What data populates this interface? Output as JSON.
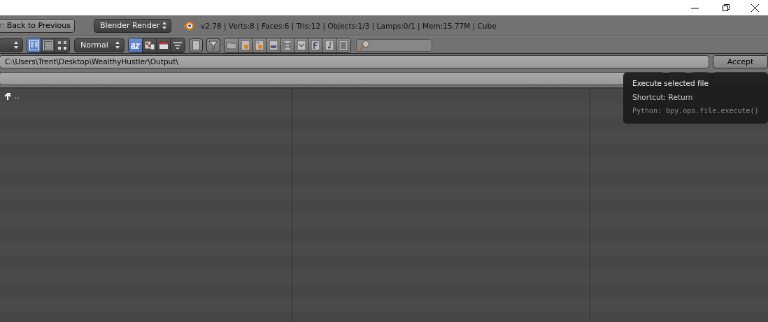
{
  "window_controls": [
    {
      "kind": "minimize"
    },
    {
      "kind": "maximize"
    },
    {
      "kind": "close"
    }
  ],
  "header": {
    "back_button": "Back to Previous",
    "render_engine": "Blender Render",
    "stats": "v2.78 | Verts:8 | Faces:6 | Tris:12 | Objects:1/3 | Lamps:0/1 | Mem:15.77M | Cube"
  },
  "toolbar": {
    "view_modes": [
      {
        "kind": "thumbnails",
        "selected": true
      },
      {
        "kind": "list",
        "selected": false
      },
      {
        "kind": "grid",
        "selected": false
      }
    ],
    "display_size": "Normal",
    "sort_modes": [
      {
        "kind": "alpha",
        "selected": true
      },
      {
        "kind": "type",
        "selected": false
      },
      {
        "kind": "date",
        "selected": false
      },
      {
        "kind": "size",
        "selected": false
      }
    ],
    "hidden_toggle": {
      "on": false
    },
    "filter_toggle": {
      "on": false
    },
    "filter_types": [
      {
        "kind": "folder"
      },
      {
        "kind": "blend"
      },
      {
        "kind": "backup"
      },
      {
        "kind": "image"
      },
      {
        "kind": "movie"
      },
      {
        "kind": "script"
      },
      {
        "kind": "font"
      },
      {
        "kind": "sound"
      },
      {
        "kind": "text"
      }
    ]
  },
  "path": "C:\\Users\\Trent\\Desktop\\WealthyHustler\\Output\\",
  "accept_button": "Accept",
  "files": [
    {
      "kind": "parent",
      "name": ".."
    }
  ],
  "tooltip": {
    "title": "Execute selected file",
    "shortcut": "Shortcut: Return",
    "python": "Python: bpy.ops.file.execute()"
  }
}
